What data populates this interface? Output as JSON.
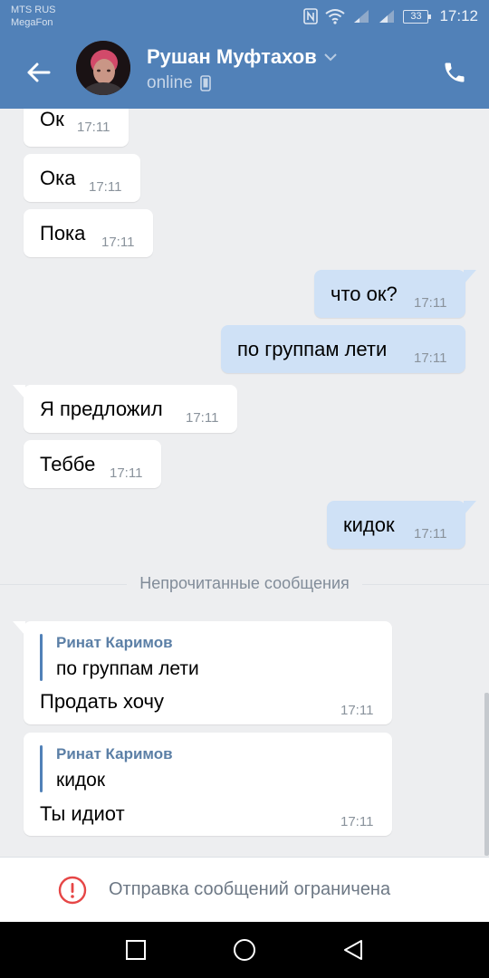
{
  "status_bar": {
    "carrier_1": "MTS RUS",
    "carrier_2": "MegaFon",
    "battery": "33",
    "time": "17:12"
  },
  "header": {
    "name": "Рушан Муфтахов",
    "status": "online",
    "accent_color": "#5181b8"
  },
  "messages": [
    {
      "dir": "in",
      "text": "Ок",
      "time": "17:11"
    },
    {
      "dir": "in",
      "text": "Ока",
      "time": "17:11"
    },
    {
      "dir": "in",
      "text": "Пока",
      "time": "17:11"
    },
    {
      "dir": "out",
      "text": "что ок?",
      "time": "17:11"
    },
    {
      "dir": "out",
      "text": "по группам лети",
      "time": "17:11"
    },
    {
      "dir": "in",
      "text": "Я предложил",
      "time": "17:11"
    },
    {
      "dir": "in",
      "text": "Теббе",
      "time": "17:11"
    },
    {
      "dir": "out",
      "text": "кидок",
      "time": "17:11"
    }
  ],
  "unread_label": "Непрочитанные сообщения",
  "forwarded_messages": [
    {
      "author": "Ринат Каримов",
      "quote": "по группам лети",
      "text": "Продать хочу",
      "time": "17:11"
    },
    {
      "author": "Ринат Каримов",
      "quote": "кидок",
      "text": "Ты идиот",
      "time": "17:11"
    }
  ],
  "restricted": {
    "text": "Отправка сообщений ограничена",
    "icon_color": "#e64646"
  },
  "icons": [
    "back-arrow-icon",
    "chevron-down-icon",
    "phone-mobile-icon",
    "call-icon",
    "alert-circle-icon",
    "nav-recents-icon",
    "nav-home-icon",
    "nav-back-icon"
  ]
}
